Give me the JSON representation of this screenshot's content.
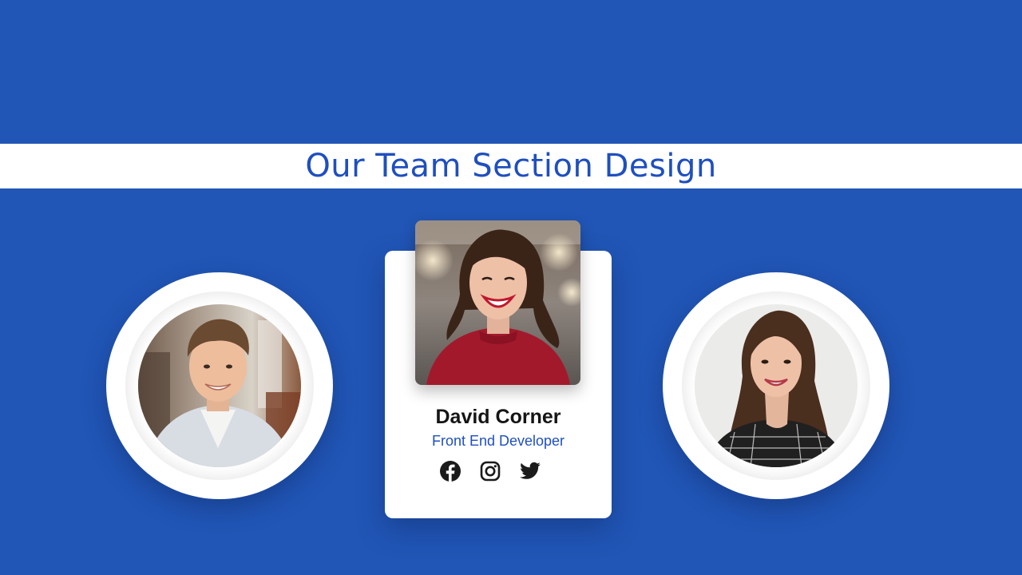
{
  "title": "Our Team Section Design",
  "featured_member": {
    "name": "David Corner",
    "role": "Front End Developer"
  },
  "socials": [
    {
      "icon": "facebook-icon"
    },
    {
      "icon": "instagram-icon"
    },
    {
      "icon": "twitter-icon"
    }
  ],
  "colors": {
    "background": "#2156b6",
    "accent": "#1f4fbf",
    "card": "#ffffff",
    "name_text": "#151515"
  }
}
